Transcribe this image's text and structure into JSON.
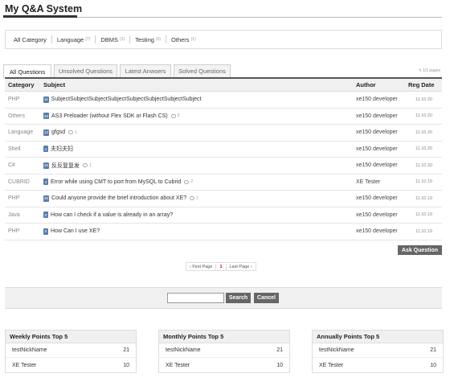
{
  "header": {
    "title": "My Q&A System"
  },
  "categories": [
    {
      "label": "All Category",
      "count": ""
    },
    {
      "label": "Language",
      "count": "(7)"
    },
    {
      "label": "DBMS",
      "count": "(1)"
    },
    {
      "label": "Testing",
      "count": "(0)"
    },
    {
      "label": "Others",
      "count": "(1)"
    }
  ],
  "tabs": [
    {
      "label": "All Questions"
    },
    {
      "label": "Unsolved Questions"
    },
    {
      "label": "Latest Anwsers"
    },
    {
      "label": "Solved Questions"
    }
  ],
  "page_info": "1/1 pages",
  "table": {
    "columns": {
      "category": "Category",
      "subject": "Subject",
      "author": "Author",
      "date": "Reg Date"
    },
    "rows": [
      {
        "category": "PHP",
        "badge": "11",
        "subject": "SubjectSubjectSubjectSubjectSubjectSubjectSubjectSubject",
        "comments": "",
        "author": "xe150 developer",
        "date": "11.10.20"
      },
      {
        "category": "Others",
        "badge": "20",
        "subject": "AS3 Preloader (without Flex SDK or Flash CS)",
        "comments": "2",
        "author": "xe150 developer",
        "date": "11.10.20"
      },
      {
        "category": "Language",
        "badge": "12",
        "subject": "gfgsd",
        "comments": "1",
        "author": "xe150 developer",
        "date": "11.10.20"
      },
      {
        "category": "Shell",
        "badge": "1",
        "subject": "夫妇夫妇",
        "comments": "",
        "author": "xe150 developer",
        "date": "11.10.20"
      },
      {
        "category": "C#",
        "badge": "20",
        "subject": "反反复复发",
        "comments": "1",
        "author": "xe150 developer",
        "date": "11.10.20"
      },
      {
        "category": "CUBRID",
        "badge": "4",
        "subject": "Error while using CMT to port from MySQL to Cubrid",
        "comments": "2",
        "author": "XE Tester",
        "date": "11.10.19"
      },
      {
        "category": "PHP",
        "badge": "20",
        "subject": "Could anyone provide the brief introduction about XE?",
        "comments": "1",
        "author": "xe150 developer",
        "date": "11.10.19"
      },
      {
        "category": "Java",
        "badge": "0",
        "subject": "How can I check if a value is already in an array?",
        "comments": "",
        "author": "xe150 developer",
        "date": "11.10.19"
      },
      {
        "category": "PHP",
        "badge": "0",
        "subject": "How Can I use XE?",
        "comments": "",
        "author": "xe150 developer",
        "date": "11.10.19"
      }
    ]
  },
  "ask_button": "Ask Question",
  "pager": {
    "first": "‹ First Page",
    "current": "1",
    "last": "Last Page ›"
  },
  "search": {
    "value": "",
    "search_label": "Search",
    "cancel_label": "Cancel"
  },
  "points": [
    {
      "title": "Weekly Points Top 5",
      "rows": [
        {
          "name": "testNickName",
          "score": "21"
        },
        {
          "name": "XE Tester",
          "score": "10"
        }
      ]
    },
    {
      "title": "Monthly Points Top 5",
      "rows": [
        {
          "name": "testNickName",
          "score": "21"
        },
        {
          "name": "XE Tester",
          "score": "10"
        }
      ]
    },
    {
      "title": "Annually Points Top 5",
      "rows": [
        {
          "name": "testNickName",
          "score": "21"
        },
        {
          "name": "XE Tester",
          "score": "10"
        }
      ]
    }
  ],
  "colors": {
    "badge": "#5a7fa8",
    "button": "#666666",
    "current_page": "#cc0000"
  }
}
